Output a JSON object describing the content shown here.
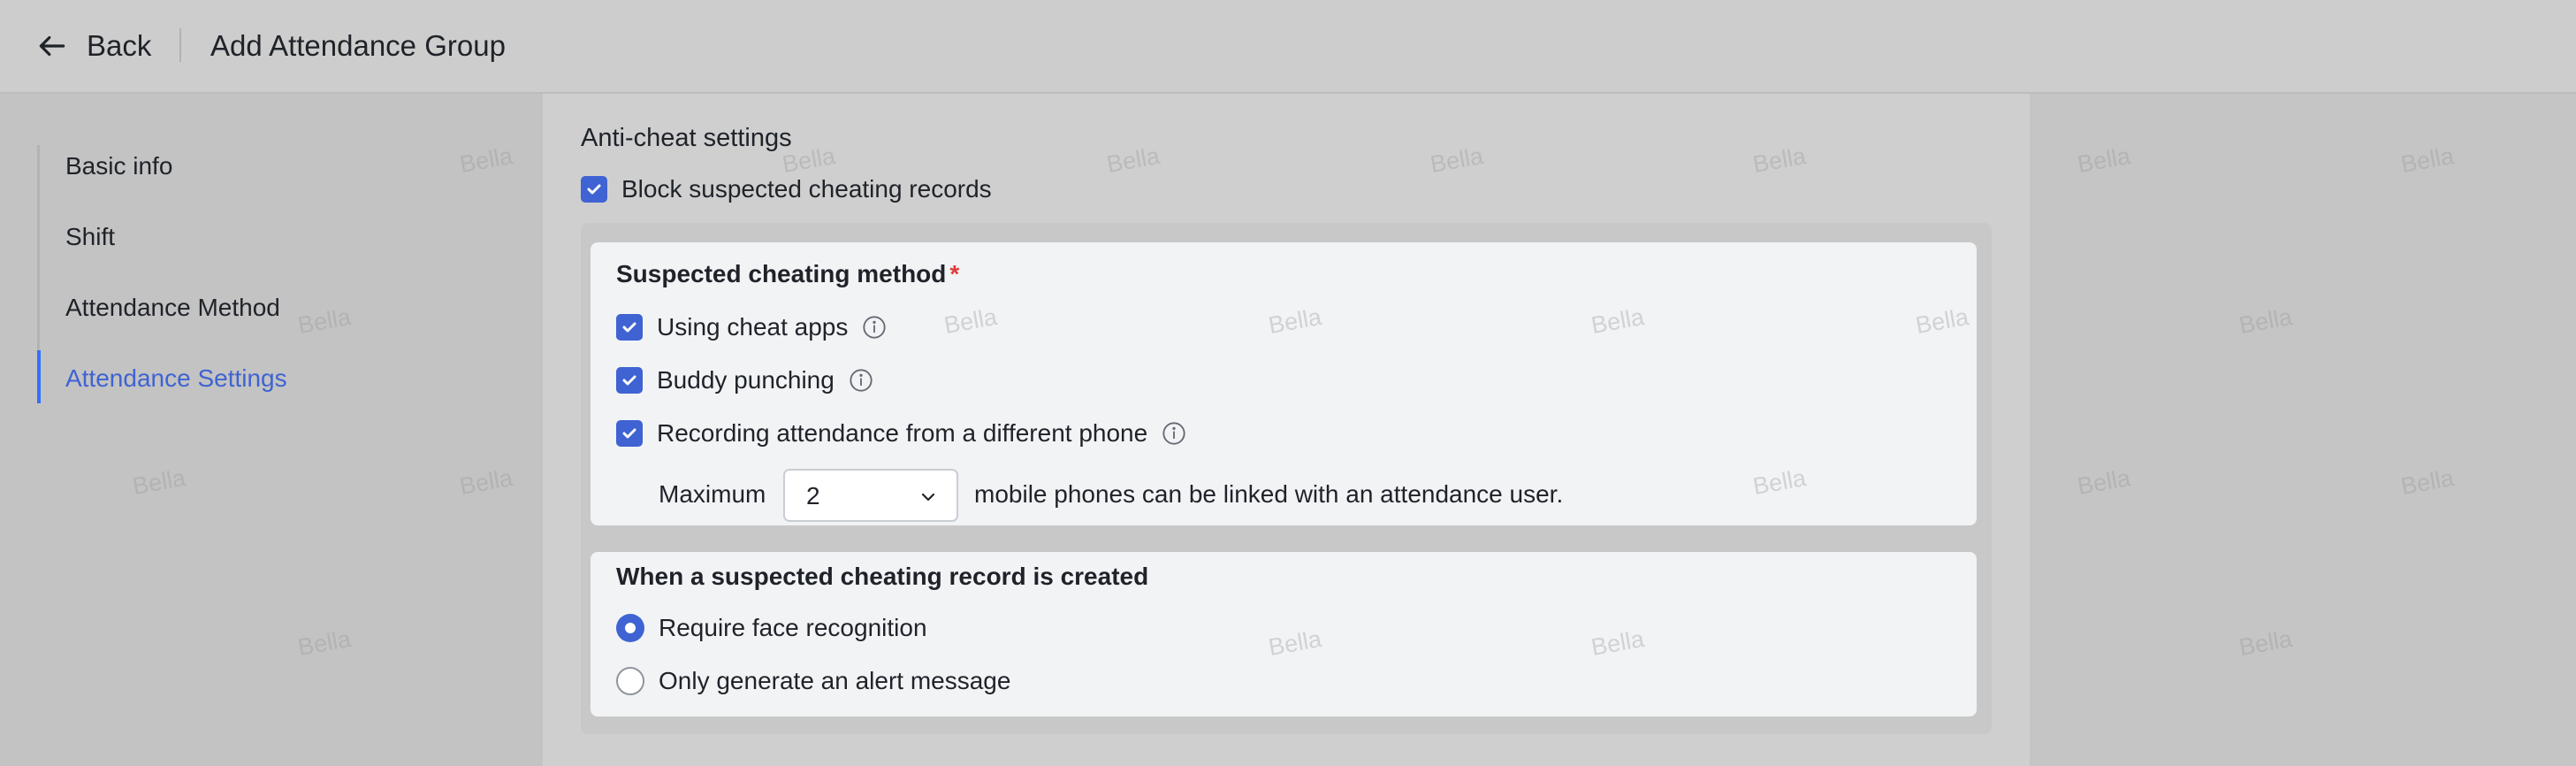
{
  "header": {
    "back_label": "Back",
    "title": "Add Attendance Group"
  },
  "nav": {
    "items": [
      {
        "label": "Basic info",
        "active": false
      },
      {
        "label": "Shift",
        "active": false
      },
      {
        "label": "Attendance Method",
        "active": false
      },
      {
        "label": "Attendance Settings",
        "active": true
      }
    ]
  },
  "anti_cheat": {
    "title": "Anti-cheat settings",
    "block_label": "Block suspected cheating records",
    "method_card": {
      "title": "Suspected cheating method",
      "required_mark": "*",
      "options": [
        {
          "label": "Using cheat apps",
          "checked": true
        },
        {
          "label": "Buddy punching",
          "checked": true
        },
        {
          "label": "Recording attendance from a different phone",
          "checked": true
        }
      ],
      "maximum_label": "Maximum",
      "maximum_value": "2",
      "maximum_suffix": "mobile phones can be linked with an attendance user."
    },
    "action_card": {
      "title": "When a suspected cheating record is created",
      "options": [
        {
          "label": "Require face recognition",
          "selected": true
        },
        {
          "label": "Only generate an alert message",
          "selected": false
        }
      ]
    }
  },
  "watermark": "Bella",
  "colors": {
    "accent": "#3f63d2",
    "required": "#e03b3b"
  }
}
